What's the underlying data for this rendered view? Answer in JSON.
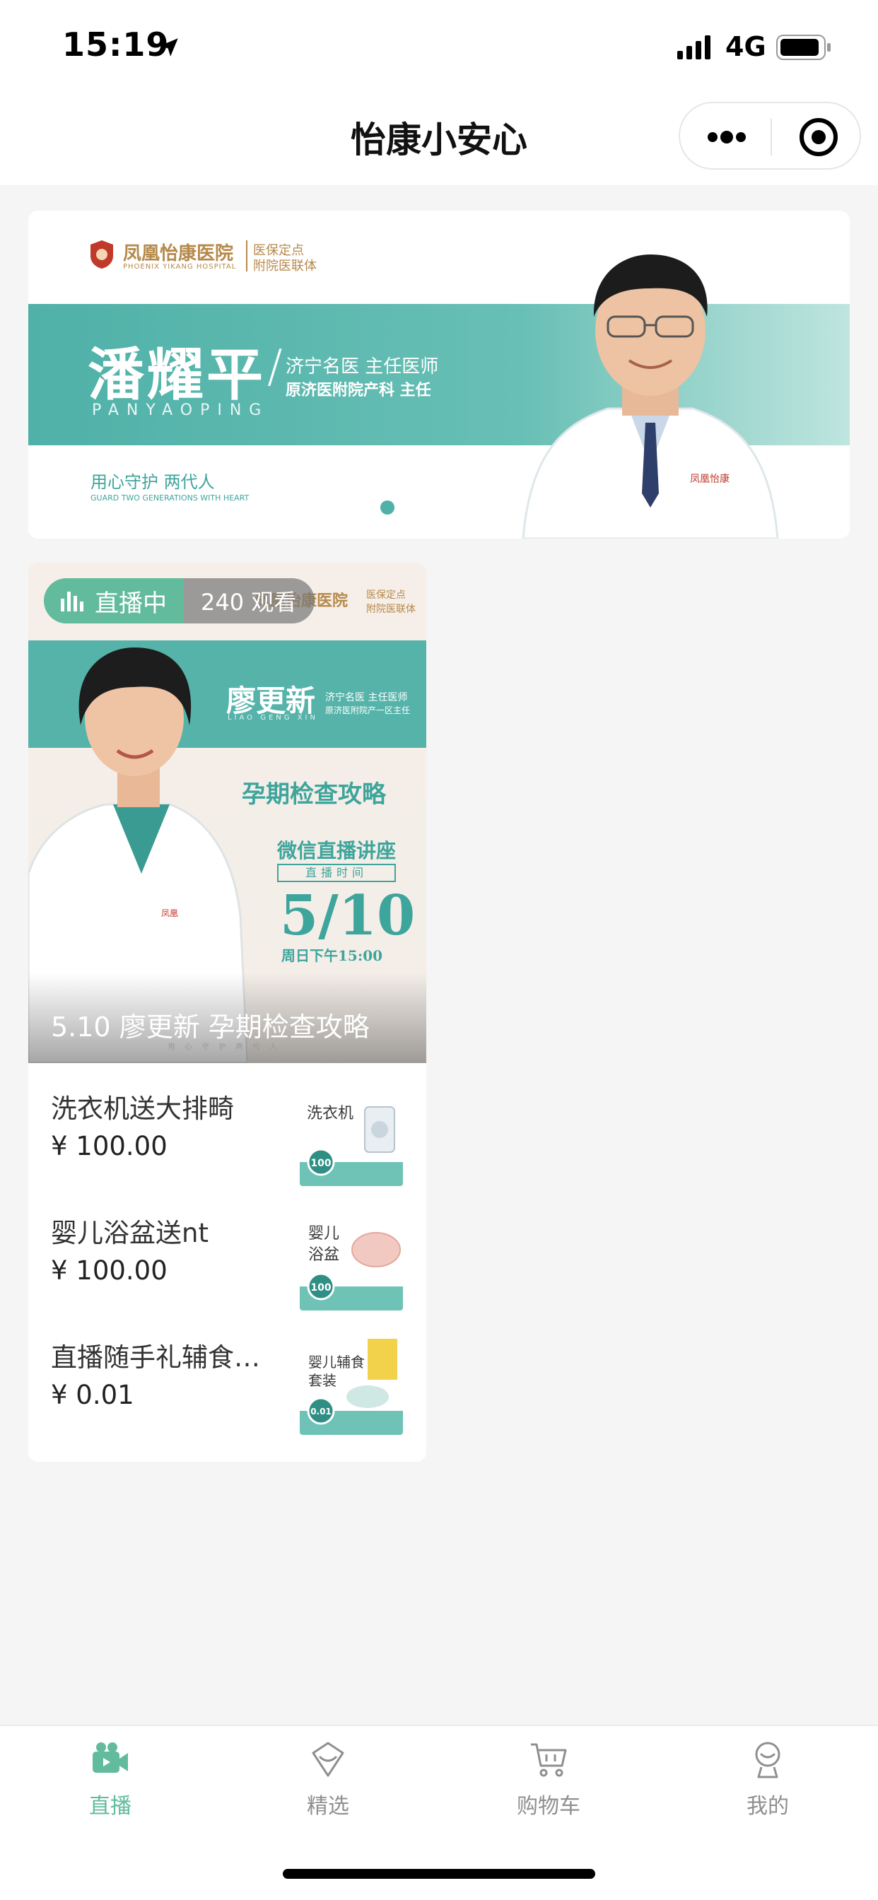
{
  "status_bar": {
    "time": "15:19",
    "network": "4G"
  },
  "nav": {
    "title": "怡康小安心"
  },
  "banner": {
    "hospital_name": "凤凰怡康医院",
    "hospital_name_en": "PHOENIX YIKANG HOSPITAL",
    "hospital_tag_1": "医保定点",
    "hospital_tag_2": "附院医联体",
    "doctor_name": "潘耀平",
    "doctor_pinyin": "PANYAOPING",
    "doctor_title_1": "济宁名医 主任医师",
    "doctor_title_2": "原济医附院产科 主任",
    "slogan": "用心守护 两代人",
    "slogan_en": "GUARD TWO GENERATIONS WITH HEART"
  },
  "live_card": {
    "status": "直播中",
    "viewers": "240 观看",
    "caption": "5.10 廖更新 孕期检查攻略",
    "poster": {
      "hospital_name": "凤凰怡康医院",
      "hospital_tag_1": "医保定点",
      "hospital_tag_2": "附院医联体",
      "doctor_name": "廖更新",
      "doctor_pinyin": "LIAO GENG XIN",
      "doctor_title_1": "济宁名医 主任医师",
      "doctor_title_2": "原济医附院产一区主任",
      "topic": "孕期检查攻略",
      "lecture": "微信直播讲座",
      "time_label": "直播时间",
      "date": "5/10",
      "hour": "周日下午15:00",
      "footer": "用心守护两代人"
    },
    "products": [
      {
        "name": "洗衣机送大排畸",
        "price": "¥ 100.00",
        "thumb_text": "洗衣机",
        "thumb_badge": "100"
      },
      {
        "name": "婴儿浴盆送nt",
        "price": "¥ 100.00",
        "thumb_text": "婴儿浴盆",
        "thumb_badge": "100"
      },
      {
        "name": "直播随手礼辅食…",
        "price": "¥ 0.01",
        "thumb_text": "婴儿辅食套装",
        "thumb_badge": "0.01"
      }
    ]
  },
  "tabbar": {
    "items": [
      {
        "label": "直播",
        "icon": "video-camera-icon",
        "active": true
      },
      {
        "label": "精选",
        "icon": "heart-badge-icon",
        "active": false
      },
      {
        "label": "购物车",
        "icon": "cart-icon",
        "active": false
      },
      {
        "label": "我的",
        "icon": "user-icon",
        "active": false
      }
    ]
  },
  "colors": {
    "accent": "#62bb9d",
    "teal": "#4fb1a8",
    "gold": "#b6894a",
    "background": "#f5f5f5"
  }
}
